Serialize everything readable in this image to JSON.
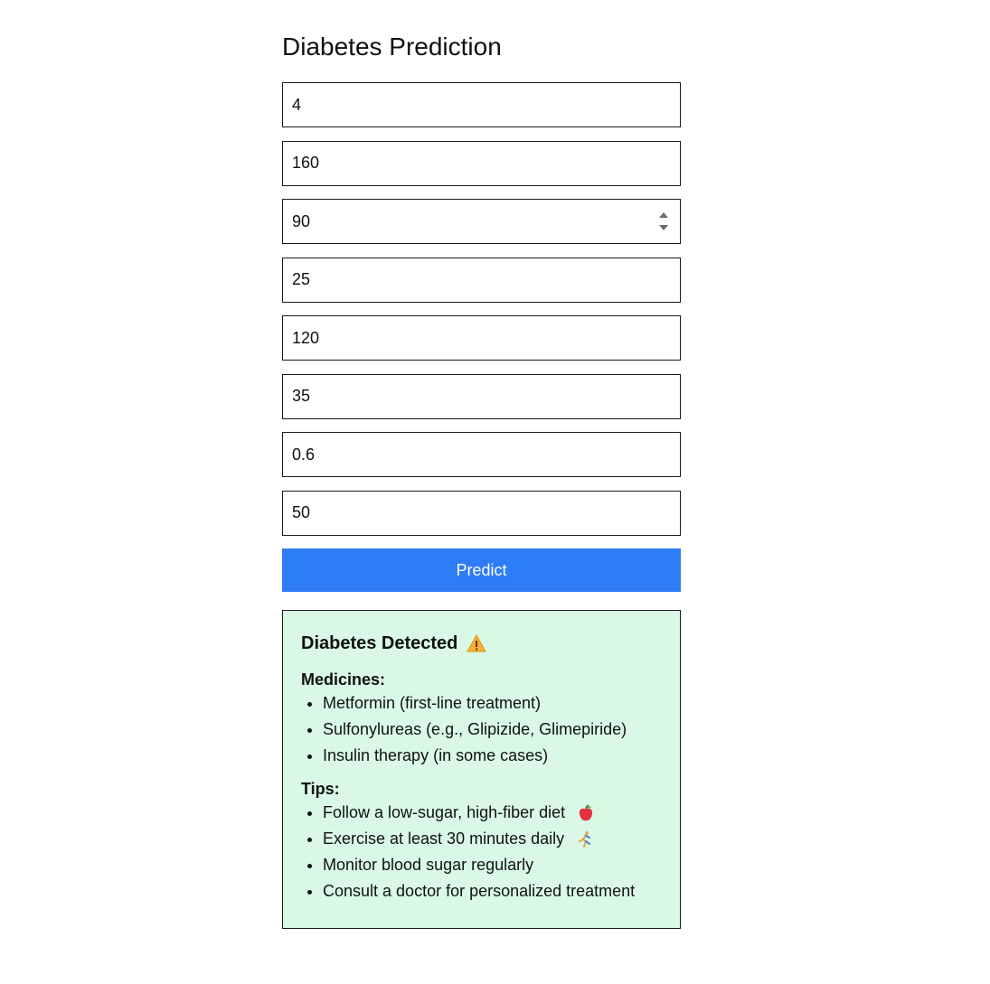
{
  "page": {
    "title": "Diabetes Prediction"
  },
  "form": {
    "fields": [
      {
        "value": "4"
      },
      {
        "value": "160"
      },
      {
        "value": "90"
      },
      {
        "value": "25"
      },
      {
        "value": "120"
      },
      {
        "value": "35"
      },
      {
        "value": "0.6"
      },
      {
        "value": "50"
      }
    ],
    "predict_label": "Predict"
  },
  "result": {
    "heading": "Diabetes Detected",
    "heading_icon": "warning-icon",
    "medicines_label": "Medicines:",
    "medicines": [
      "Metformin (first-line treatment)",
      "Sulfonylureas (e.g., Glipizide, Glimepiride)",
      "Insulin therapy (in some cases)"
    ],
    "tips_label": "Tips:",
    "tips": [
      "Follow a low-sugar, high-fiber diet",
      "Exercise at least 30 minutes daily",
      "Monitor blood sugar regularly",
      "Consult a doctor for personalized treatment"
    ],
    "tip_icons": [
      "apple-icon",
      "runner-icon"
    ]
  },
  "colors": {
    "button_bg": "#2e7cf6",
    "result_bg": "#d9f9e6"
  }
}
